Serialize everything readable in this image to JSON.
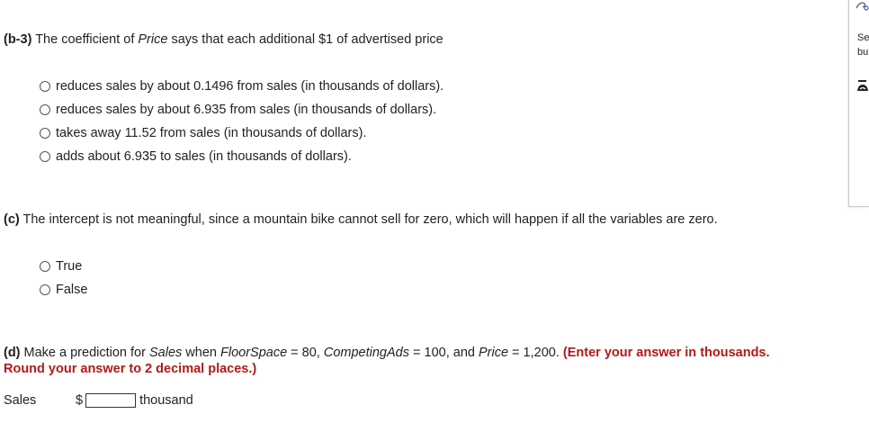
{
  "b3": {
    "label": "(b-3)",
    "text_pre": " The coefficient of ",
    "text_var": "Price",
    "text_post": " says that each additional $1 of advertised price",
    "options": [
      "reduces sales by about 0.1496 from sales (in thousands of dollars).",
      "reduces sales by about 6.935 from sales (in thousands of dollars).",
      "takes away 11.52 from sales (in thousands of dollars).",
      "adds about 6.935 to sales (in thousands of dollars)."
    ]
  },
  "c": {
    "label": "(c)",
    "text": " The intercept is not meaningful, since a mountain bike cannot sell for zero, which will happen if all the variables are zero.",
    "options": [
      "True",
      "False"
    ]
  },
  "d": {
    "label": "(d)",
    "t1": " Make a prediction for ",
    "v1": "Sales",
    "t2": " when ",
    "v2": "FloorSpace",
    "t3": " = 80, ",
    "v3": "CompetingAds",
    "t4": " = 100, and ",
    "v4": "Price",
    "t5": " = 1,200. ",
    "instruction_line1": "(Enter your answer in thousands.",
    "instruction_line2": "Round your answer to 2 decimal places.)",
    "sales_label": "Sales",
    "currency": "$",
    "input_value": "",
    "unit": "thousand"
  },
  "side_panel": {
    "line1": "Se",
    "line2": "bu"
  },
  "colors": {
    "accent_red": "#b01a1a"
  }
}
